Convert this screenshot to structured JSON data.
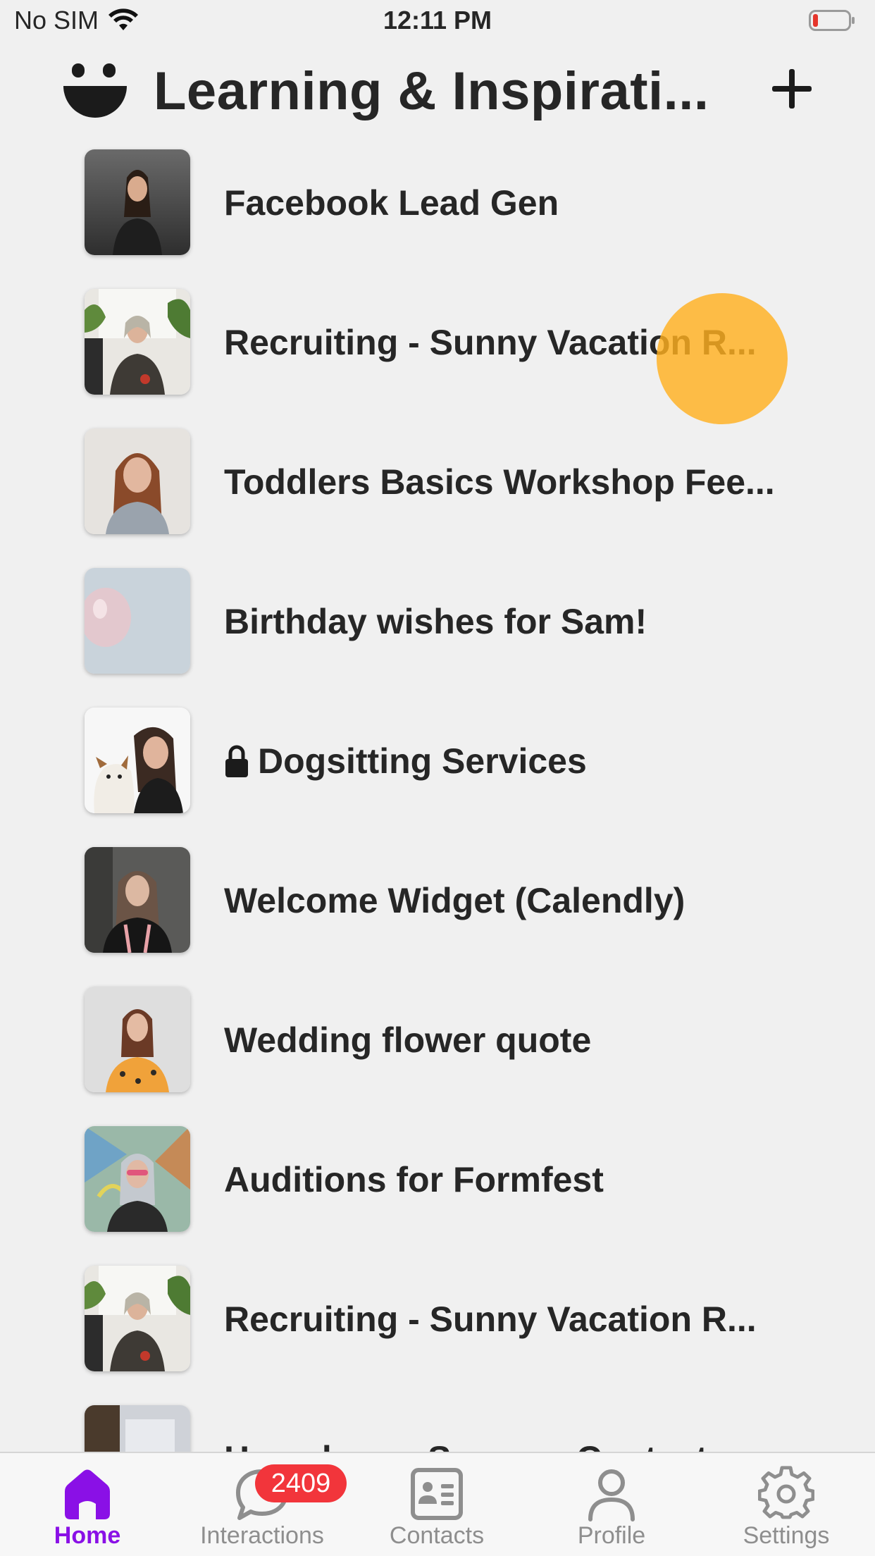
{
  "status_bar": {
    "carrier": "No SIM",
    "time": "12:11 PM",
    "battery_color": "#e5352b"
  },
  "header": {
    "title": "Learning & Inspirati...",
    "add_icon": "plus-icon",
    "logo_icon": "smiley-logo-icon"
  },
  "list": {
    "items": [
      {
        "label": "Facebook Lead Gen",
        "locked": false,
        "thumb": "woman-dark-background"
      },
      {
        "label": "Recruiting - Sunny Vacation R...",
        "locked": false,
        "thumb": "woman-with-plants"
      },
      {
        "label": "Toddlers Basics Workshop Fee...",
        "locked": false,
        "thumb": "woman-long-hair"
      },
      {
        "label": "Birthday wishes for Sam!",
        "locked": false,
        "thumb": "balloon"
      },
      {
        "label": "Dogsitting Services",
        "locked": true,
        "thumb": "woman-with-dog"
      },
      {
        "label": "Welcome Widget (Calendly)",
        "locked": false,
        "thumb": "woman-black-shirt"
      },
      {
        "label": "Wedding flower quote",
        "locked": false,
        "thumb": "woman-floral-dress"
      },
      {
        "label": "Auditions for Formfest",
        "locked": false,
        "thumb": "woman-mural"
      },
      {
        "label": "Recruiting - Sunny Vacation R...",
        "locked": false,
        "thumb": "woman-with-plants"
      },
      {
        "label": "Homebuyer Survey - Contact",
        "locked": false,
        "thumb": "doorway"
      }
    ]
  },
  "tab_bar": {
    "tabs": [
      {
        "label": "Home",
        "icon": "home-icon",
        "active": true
      },
      {
        "label": "Interactions",
        "icon": "chat-bubble-icon",
        "active": false,
        "badge": "2409"
      },
      {
        "label": "Contacts",
        "icon": "contact-card-icon",
        "active": false
      },
      {
        "label": "Profile",
        "icon": "person-icon",
        "active": false
      },
      {
        "label": "Settings",
        "icon": "gear-icon",
        "active": false
      }
    ],
    "active_color": "#8a10e6",
    "inactive_color": "#8e8e8e",
    "badge_color": "#f2353b"
  }
}
